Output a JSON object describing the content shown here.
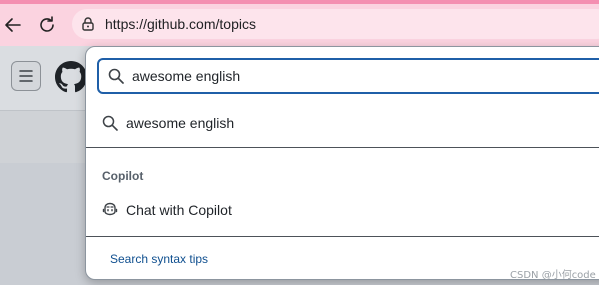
{
  "browser": {
    "url": "https://github.com/topics",
    "icons": {
      "back": "arrow-left-icon",
      "reload": "reload-icon",
      "lock": "lock-icon"
    },
    "colors": {
      "chrome": "#fbd3e0",
      "accent": "#f48fb1"
    }
  },
  "page": {
    "icons": {
      "menu": "hamburger-menu-icon",
      "logo": "github-logo-icon"
    }
  },
  "search": {
    "query": "awesome english",
    "icon": "search-icon",
    "focus_color": "#1f5fa8",
    "suggestions": [
      {
        "label": "awesome english",
        "icon": "search-icon"
      }
    ],
    "sections": [
      {
        "title": "Copilot",
        "items": [
          {
            "label": "Chat with Copilot",
            "icon": "copilot-icon"
          }
        ]
      }
    ],
    "footer_link": "Search syntax tips"
  },
  "watermark": "CSDN @小何code"
}
